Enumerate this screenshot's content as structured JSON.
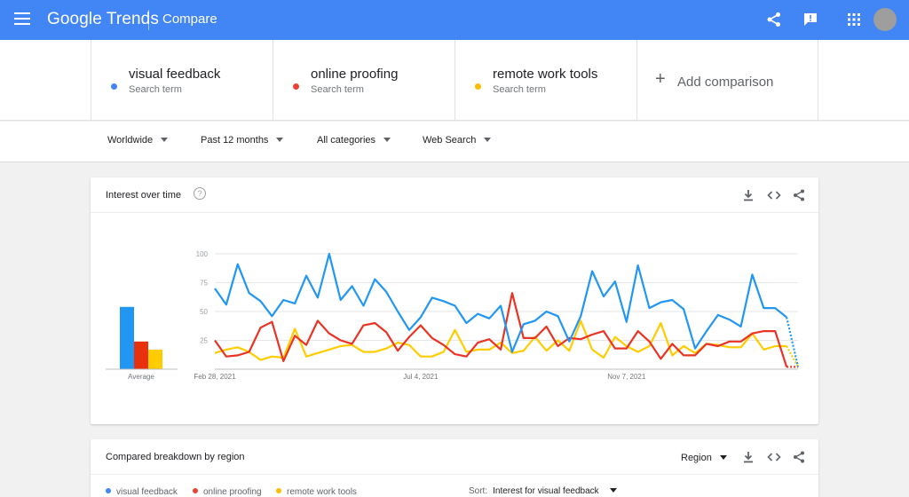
{
  "header": {
    "brand_google": "Google",
    "brand_trends": "Trends",
    "page_title": "Compare",
    "color": "#4285f4"
  },
  "terms": [
    {
      "name": "visual feedback",
      "sub": "Search term",
      "color": "#4285f4"
    },
    {
      "name": "online proofing",
      "sub": "Search term",
      "color": "#ea4335"
    },
    {
      "name": "remote work tools",
      "sub": "Search term",
      "color": "#fbbc04"
    }
  ],
  "add_comparison": "Add comparison",
  "filters": {
    "region": "Worldwide",
    "time": "Past 12 months",
    "category": "All categories",
    "property": "Web Search"
  },
  "interest_card": {
    "title": "Interest over time",
    "help": "?"
  },
  "region_card": {
    "title": "Compared breakdown by region",
    "region_select": "Region",
    "sort_label": "Sort:",
    "sort_value": "Interest for visual feedback",
    "legend": [
      "visual feedback",
      "online proofing",
      "remote work tools"
    ]
  },
  "chart_data": {
    "type": "line",
    "ylim": [
      0,
      100
    ],
    "yticks": [
      25,
      50,
      75,
      100
    ],
    "x_tick_labels": [
      "Feb 28, 2021",
      "Jul 4, 2021",
      "Nov 7, 2021"
    ],
    "x_tick_index": [
      0,
      18,
      36
    ],
    "average_label": "Average",
    "averages": [
      54,
      24,
      17
    ],
    "series": [
      {
        "name": "visual feedback",
        "color": "#1a73e8",
        "values": [
          70,
          56,
          91,
          66,
          59,
          46,
          60,
          57,
          81,
          62,
          100,
          60,
          72,
          55,
          78,
          67,
          50,
          34,
          45,
          62,
          59,
          55,
          40,
          48,
          44,
          55,
          15,
          39,
          42,
          50,
          46,
          24,
          46,
          85,
          63,
          76,
          41,
          90,
          53,
          58,
          60,
          52,
          18,
          33,
          47,
          43,
          37,
          82,
          53,
          53,
          45,
          2
        ]
      },
      {
        "name": "online proofing",
        "color": "#ea4335",
        "values": [
          25,
          11,
          12,
          15,
          36,
          41,
          7,
          29,
          21,
          42,
          31,
          25,
          22,
          38,
          40,
          32,
          16,
          28,
          38,
          27,
          21,
          13,
          11,
          23,
          26,
          17,
          66,
          27,
          27,
          37,
          20,
          27,
          26,
          30,
          33,
          18,
          18,
          33,
          24,
          9,
          22,
          12,
          12,
          22,
          20,
          24,
          24,
          31,
          33,
          33,
          2,
          2
        ]
      },
      {
        "name": "remote work tools",
        "color": "#fbbc04",
        "values": [
          14,
          17,
          19,
          15,
          8,
          11,
          10,
          35,
          11,
          14,
          17,
          20,
          21,
          15,
          15,
          18,
          23,
          21,
          11,
          11,
          15,
          34,
          15,
          17,
          17,
          23,
          14,
          16,
          28,
          16,
          25,
          16,
          42,
          17,
          10,
          28,
          20,
          15,
          20,
          40,
          12,
          20,
          14,
          22,
          21,
          19,
          19,
          31,
          17,
          20,
          20,
          2
        ]
      }
    ]
  }
}
